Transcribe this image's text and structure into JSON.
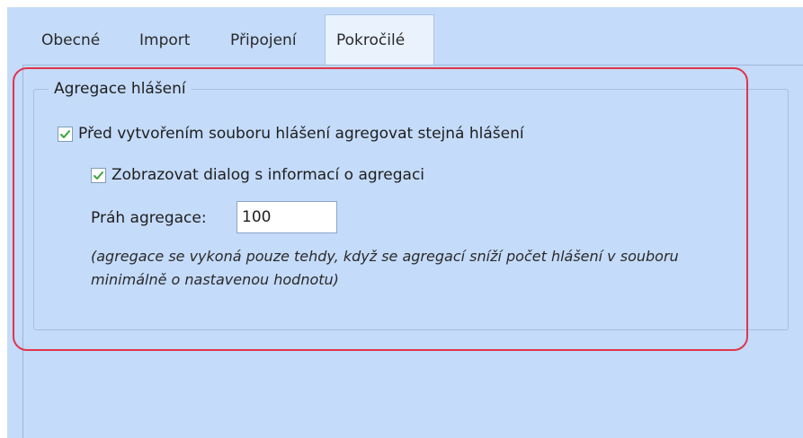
{
  "tabs": [
    {
      "label": "Obecné",
      "active": false
    },
    {
      "label": "Import",
      "active": false
    },
    {
      "label": "Připojení",
      "active": false
    },
    {
      "label": "Pokročilé",
      "active": true
    }
  ],
  "group": {
    "title": "Agregace hlášení",
    "aggregate_checkbox": {
      "label": "Před vytvořením souboru hlášení agregovat stejná hlášení",
      "checked": true
    },
    "dialog_checkbox": {
      "label": "Zobrazovat dialog s informací o agregaci",
      "checked": true
    },
    "threshold_label": "Práh agregace:",
    "threshold_value": "100",
    "note": "(agregace se vykoná pouze tehdy, když se agregací sníží počet hlášení v souboru minimálně o nastavenou hodnotu)"
  },
  "colors": {
    "background": "#c4dbf9",
    "active_tab": "#e9f2fd",
    "highlight": "#e0354e",
    "check": "#3aa53a"
  }
}
